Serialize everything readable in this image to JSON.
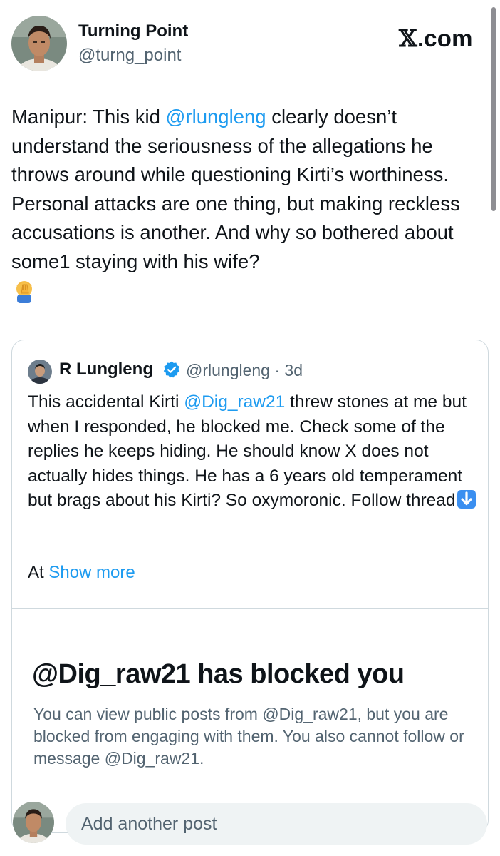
{
  "header": {
    "display_name": "Turning Point",
    "handle": "@turng_point",
    "brand_x": "𝕏",
    "brand_suffix": ".com"
  },
  "tweet": {
    "text_before_mention": "Manipur: This kid ",
    "mention": "@rlungleng",
    "text_after_mention": " clearly doesn’t understand the seriousness of the allegations he throws around while questioning Kirti’s worthiness. Personal attacks are one thing, but making reckless accusations is another. And why so bothered about some1 staying with his wife?",
    "emoji_icon": "facepalm-emoji"
  },
  "quote": {
    "name": "R Lungleng",
    "verified_icon": "verified-badge-icon",
    "handle_and_time": "@rlungleng · 3d",
    "text_before_mention": "This accidental Kirti ",
    "mention": "@Dig_raw21",
    "text_after_mention": "  threw stones at me but when I responded, he blocked me. Check some of the replies he keeps hiding. He should know X does not actually hides things. He has a 6 years old temperament but brags about his Kirti? So oxymoronic. Follow thread",
    "arrow_icon": "down-arrow-emoji",
    "truncated_prefix": "At ",
    "show_more": "Show more"
  },
  "blocked_image": {
    "title": "@Dig_raw21 has blocked you",
    "description": "You can view public posts from @Dig_raw21, but you are blocked from engaging with them. You also cannot follow or message @Dig_raw21."
  },
  "composer": {
    "placeholder": "Add another post"
  },
  "colors": {
    "link": "#1d9bf0",
    "text": "#0f1419",
    "muted": "#536471",
    "border": "#cfd9de",
    "input_bg": "#eff3f4"
  }
}
